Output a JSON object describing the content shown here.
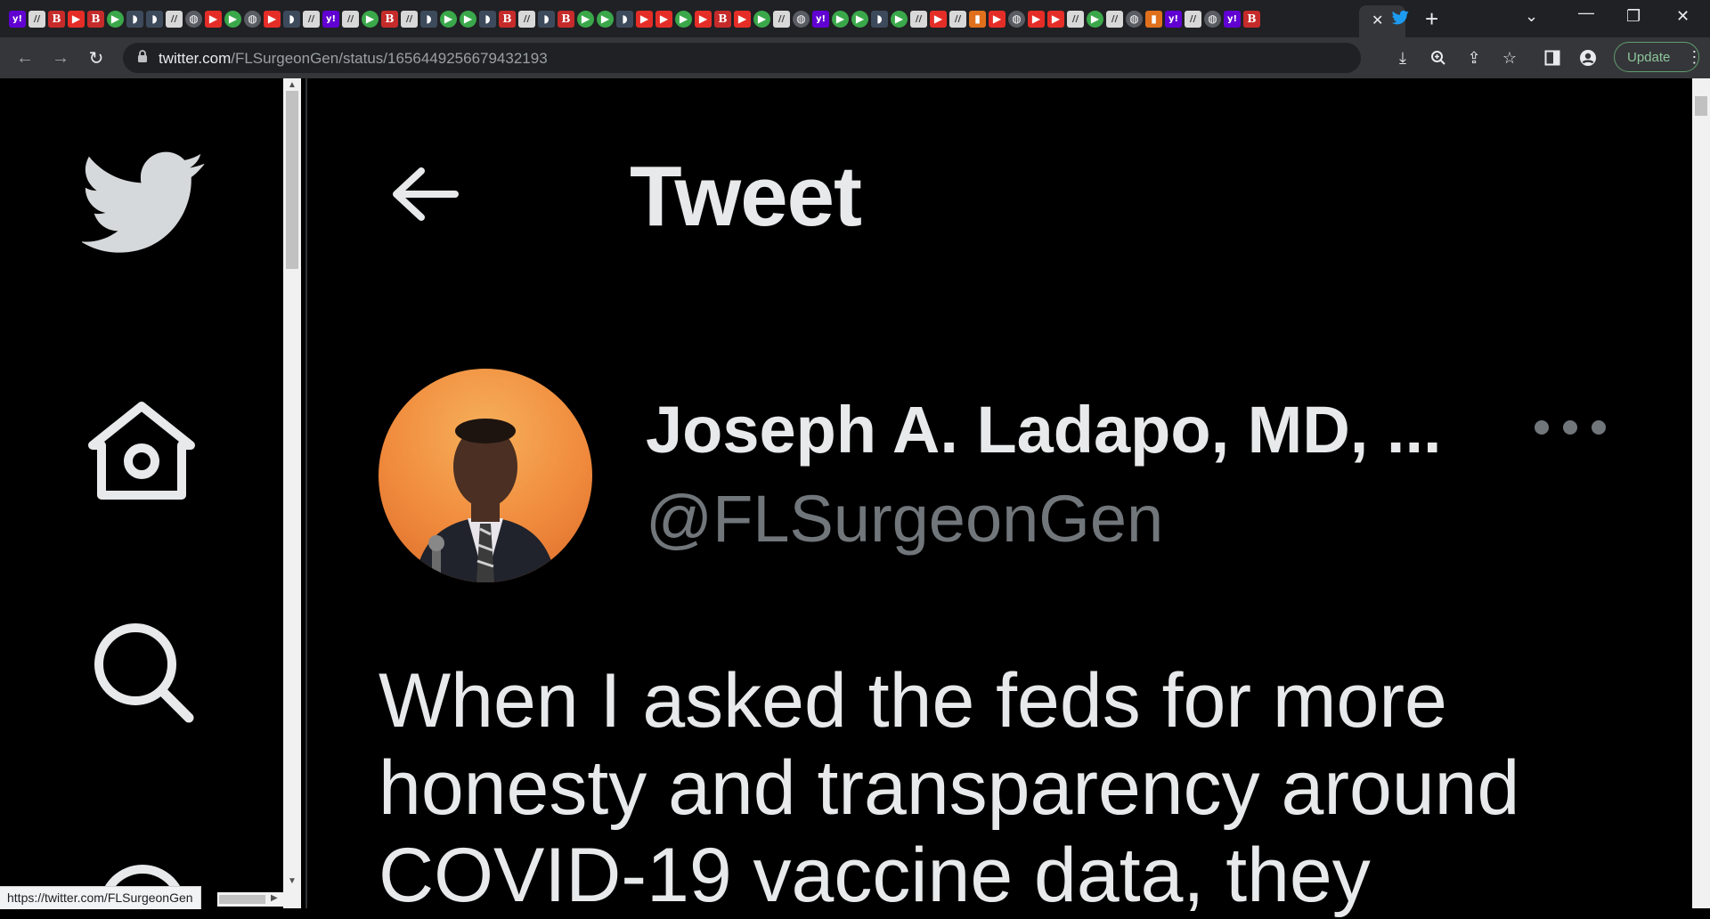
{
  "browser": {
    "tab_favicons": [
      "y",
      "w",
      "b",
      "r",
      "b",
      "g",
      "s",
      "s",
      "w",
      "k",
      "r",
      "g",
      "k",
      "r",
      "s",
      "w",
      "y",
      "w",
      "g",
      "b",
      "w",
      "s",
      "g",
      "g",
      "s",
      "b",
      "w",
      "s",
      "b",
      "g",
      "g",
      "s",
      "r",
      "r",
      "g",
      "r",
      "b",
      "r",
      "g",
      "w",
      "k",
      "y",
      "g",
      "g",
      "s",
      "g",
      "w",
      "r",
      "w",
      "o",
      "r",
      "k",
      "r",
      "r",
      "w",
      "g",
      "w",
      "k",
      "o",
      "y",
      "w",
      "k",
      "y",
      "b"
    ],
    "active_tab_close": "✕",
    "new_tab": "+",
    "url_host": "twitter.com",
    "url_path": "/FLSurgeonGen/status/1656449256679432193",
    "update_label": "Update",
    "status_url": "https://twitter.com/FLSurgeonGen"
  },
  "page": {
    "header_title": "Tweet",
    "author": {
      "display_name": "Joseph A. Ladapo, MD, ...",
      "handle": "@FLSurgeonGen"
    },
    "tweet_text": "When I asked the feds for more honesty and transparency around COVID-19 vaccine data, they"
  },
  "colors": {
    "background": "#000000",
    "text": "#e7e9ea",
    "muted": "#71767b",
    "twitter_blue": "#1d9bf0"
  }
}
